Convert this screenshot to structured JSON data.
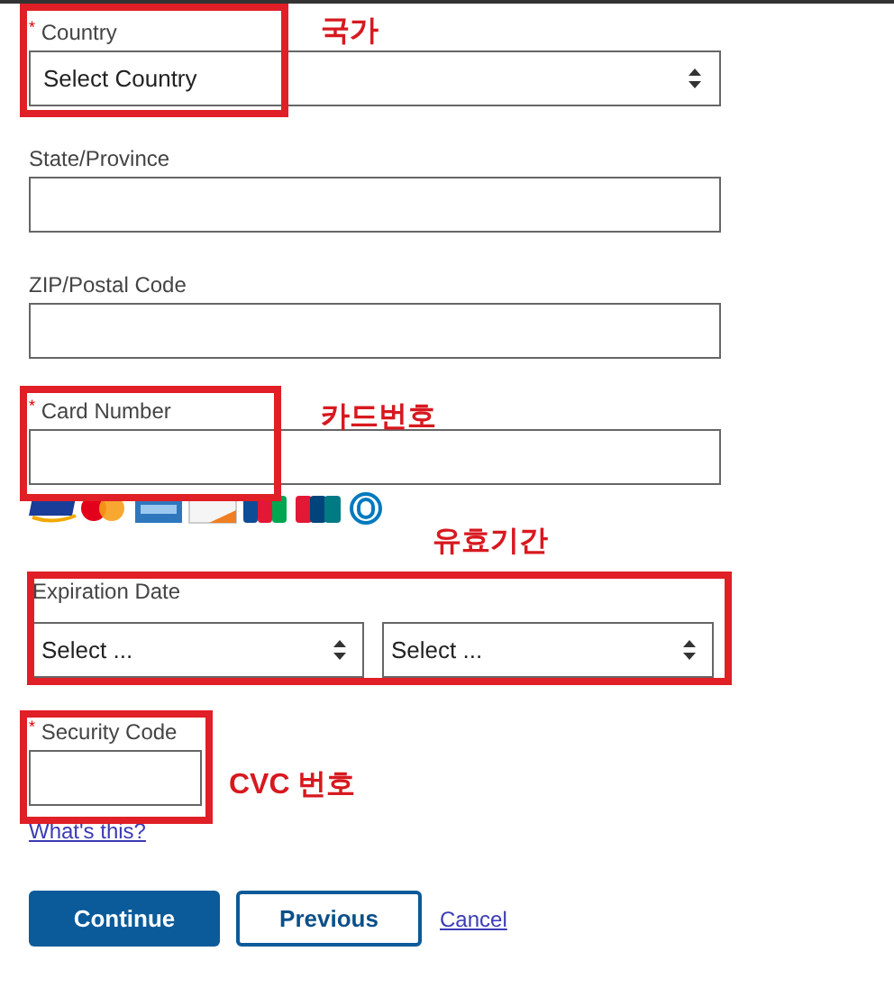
{
  "fields": [
    {
      "kind": "select",
      "label": "Country",
      "marker": "*",
      "placeholder": "Select Country"
    },
    {
      "kind": "text",
      "label": "State/Province"
    },
    {
      "kind": "text",
      "label": "ZIP/Postal Code"
    },
    {
      "kind": "text",
      "label": "Card Number",
      "marker": "*"
    },
    {
      "kind": "card-logos"
    },
    {
      "kind": "select-pair",
      "label": "Expiration Date",
      "placeholders": [
        "Select ...",
        "Select ..."
      ]
    },
    {
      "kind": "short-text",
      "label": "Security Code",
      "marker": "*"
    },
    {
      "kind": "link",
      "label": "What's this?"
    }
  ],
  "buttons": [
    {
      "kind": "primary",
      "label": "Continue"
    },
    {
      "kind": "secondary",
      "label": "Previous"
    },
    {
      "kind": "link",
      "label": "Cancel"
    }
  ],
  "annotations": [
    {
      "text": "국가"
    },
    {
      "text": "카드번호"
    },
    {
      "text": "유효기간"
    },
    {
      "text": "CVC 번호"
    }
  ]
}
